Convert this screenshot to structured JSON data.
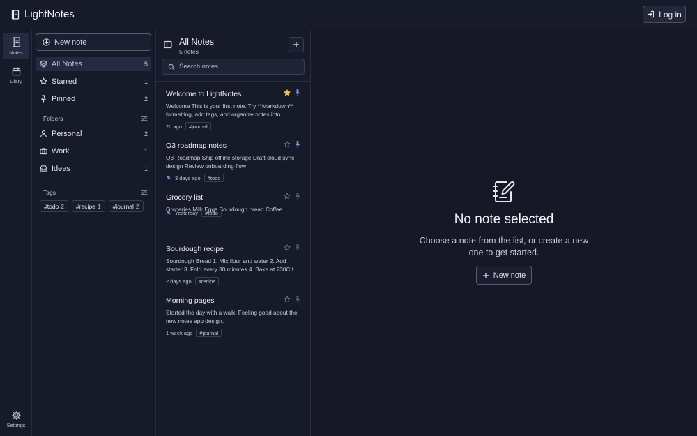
{
  "app": {
    "title": "LightNotes",
    "login_label": "Log in"
  },
  "rail": {
    "items": [
      {
        "label": "Notes",
        "icon": "notebook-icon",
        "active": true
      },
      {
        "label": "Diary",
        "icon": "calendar-icon",
        "active": false
      }
    ],
    "settings_label": "Settings"
  },
  "sidebar": {
    "new_note_label": "New note",
    "nav": [
      {
        "label": "All Notes",
        "count": "5",
        "icon": "layers-icon",
        "active": true
      },
      {
        "label": "Starred",
        "count": "1",
        "icon": "star-icon"
      },
      {
        "label": "Pinned",
        "count": "2",
        "icon": "pin-icon"
      }
    ],
    "folders_label": "Folders",
    "folders": [
      {
        "label": "Personal",
        "count": "2",
        "icon": "user-icon"
      },
      {
        "label": "Work",
        "count": "1",
        "icon": "briefcase-icon"
      },
      {
        "label": "Ideas",
        "count": "1",
        "icon": "inbox-icon"
      }
    ],
    "tags_label": "Tags",
    "tags": [
      {
        "label": "#todo",
        "count": "2"
      },
      {
        "label": "#recipe",
        "count": "1"
      },
      {
        "label": "#journal",
        "count": "2"
      }
    ]
  },
  "notelist": {
    "title": "All Notes",
    "subtitle": "5 notes",
    "search_placeholder": "Search notes...",
    "notes": [
      {
        "title": "Welcome to LightNotes",
        "preview": "Welcome This is your first note. Try **Markdown** formatting, add tags, and organize notes into...",
        "time": "2h ago",
        "tag": "#journal",
        "starred": true,
        "pinned": true,
        "sync": false
      },
      {
        "title": "Q3 roadmap notes",
        "preview": "Q3 Roadmap Ship offline storage Draft cloud sync design Review onboarding flow",
        "time": "3 days ago",
        "tag": "#todo",
        "starred": false,
        "pinned": true,
        "sync": true
      },
      {
        "title": "Grocery list",
        "preview": "Groceries Milk Eggs Sourdough bread Coffee",
        "time": "Yesterday",
        "tag": "#todo",
        "starred": false,
        "pinned": false,
        "sync": true
      },
      {
        "title": "Sourdough recipe",
        "preview": "Sourdough Bread 1. Mix flour and water 2. Add starter 3. Fold every 30 minutes 4. Bake at 230C f...",
        "time": "2 days ago",
        "tag": "#recipe",
        "starred": false,
        "pinned": false,
        "sync": false
      },
      {
        "title": "Morning pages",
        "preview": "Started the day with a walk. Feeling good about the new notes app design.",
        "time": "1 week ago",
        "tag": "#journal",
        "starred": false,
        "pinned": false,
        "sync": false
      }
    ]
  },
  "main": {
    "empty_title": "No note selected",
    "empty_desc": "Choose a note from the list, or create a new one to get started.",
    "new_note_label": "New note"
  },
  "colors": {
    "background": "#161827",
    "panel": "#171a29",
    "border": "#2a2d40",
    "star_active": "#f2c744",
    "pin_active": "#8f8cf2",
    "icon_muted": "#6f7388"
  }
}
